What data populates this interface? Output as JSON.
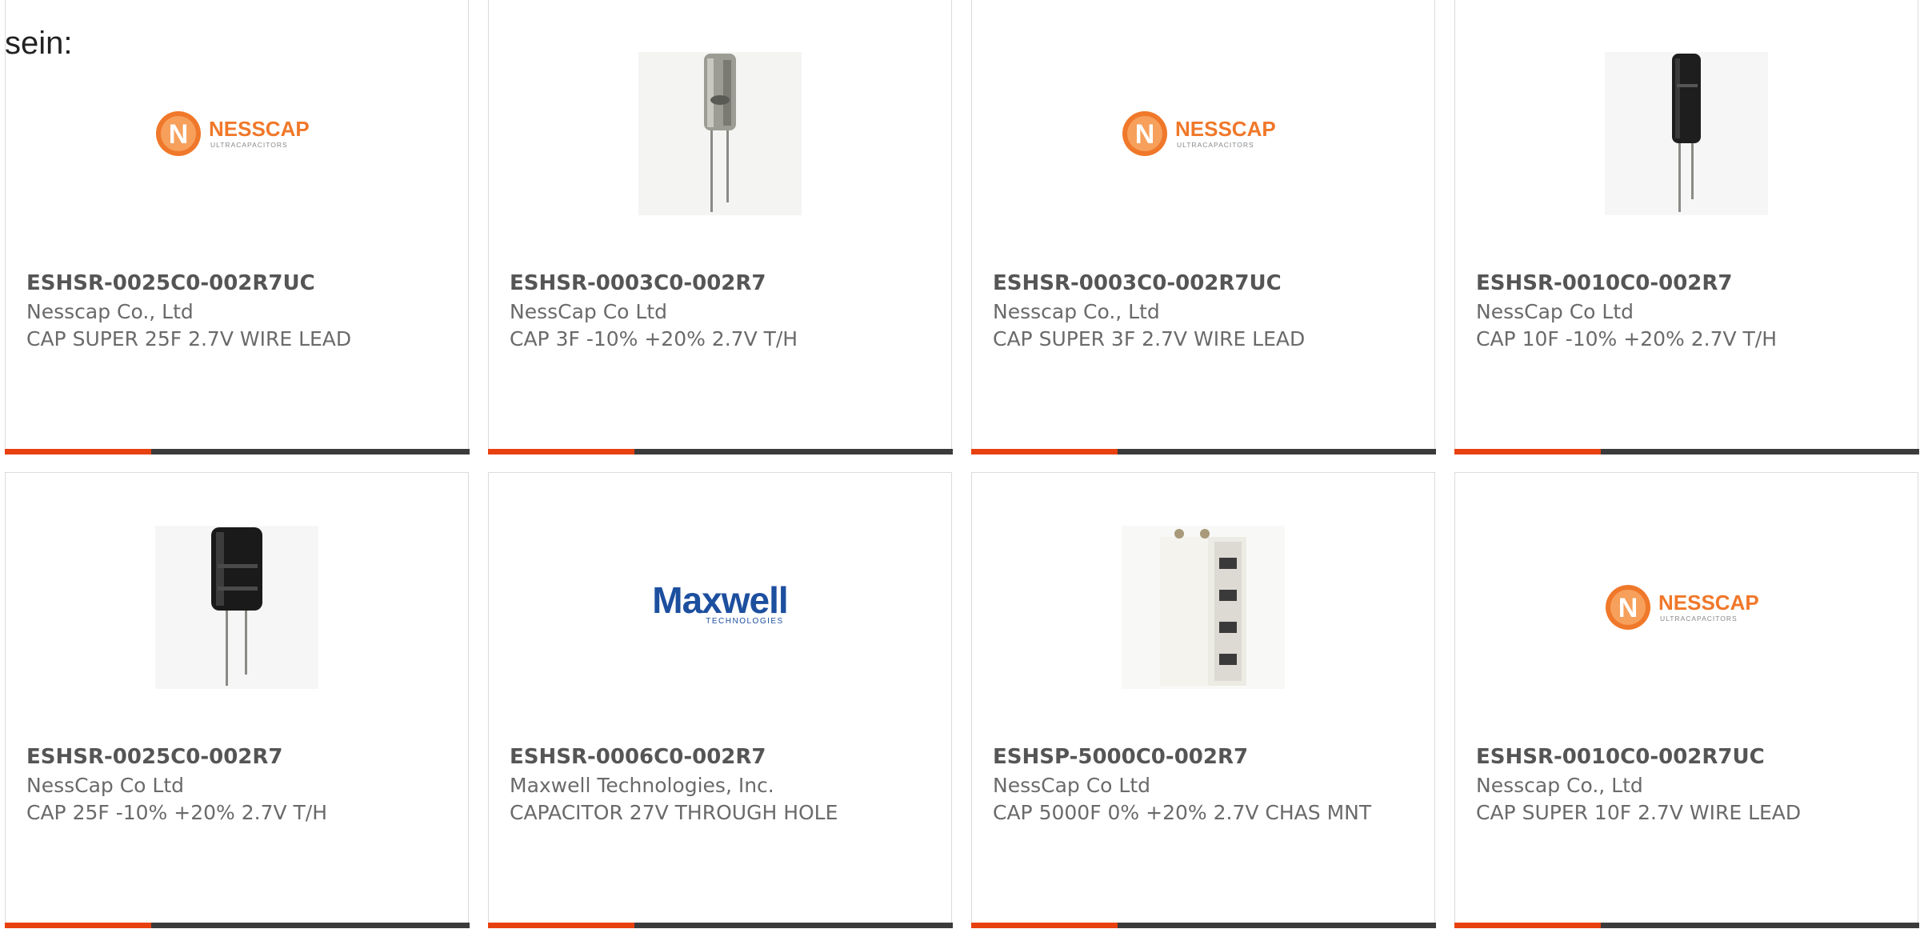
{
  "intro_text": "sein:",
  "colors": {
    "accent": "#e8410f",
    "bar": "#3b3b3b",
    "nesscap_orange": "#f0782a",
    "maxwell_blue": "#1d4f9f"
  },
  "products": [
    {
      "part_number": "ESHSR-0025C0-002R7UC",
      "manufacturer": "Nesscap Co., Ltd",
      "description": "CAP SUPER 25F 2.7V WIRE LEAD",
      "image": "nesscap-logo",
      "logo_text": "NESSCAP",
      "logo_sub": "ULTRACAPACITORS"
    },
    {
      "part_number": "ESHSR-0003C0-002R7",
      "manufacturer": "NessCap Co Ltd",
      "description": "CAP 3F -10% +20% 2.7V T/H",
      "image": "capacitor-small-grey"
    },
    {
      "part_number": "ESHSR-0003C0-002R7UC",
      "manufacturer": "Nesscap Co., Ltd",
      "description": "CAP SUPER 3F 2.7V WIRE LEAD",
      "image": "nesscap-logo",
      "logo_text": "NESSCAP",
      "logo_sub": "ULTRACAPACITORS"
    },
    {
      "part_number": "ESHSR-0010C0-002R7",
      "manufacturer": "NessCap Co Ltd",
      "description": "CAP 10F -10% +20% 2.7V T/H",
      "image": "capacitor-black-slim"
    },
    {
      "part_number": "ESHSR-0025C0-002R7",
      "manufacturer": "NessCap Co Ltd",
      "description": "CAP 25F -10% +20% 2.7V T/H",
      "image": "capacitor-black-wide"
    },
    {
      "part_number": "ESHSR-0006C0-002R7",
      "manufacturer": "Maxwell Technologies, Inc.",
      "description": "CAPACITOR 27V THROUGH HOLE",
      "image": "maxwell-logo",
      "logo_text": "Maxwell",
      "logo_sub": "TECHNOLOGIES"
    },
    {
      "part_number": "ESHSP-5000C0-002R7",
      "manufacturer": "NessCap Co Ltd",
      "description": "CAP 5000F 0% +20% 2.7V CHAS MNT",
      "image": "capacitor-block-white"
    },
    {
      "part_number": "ESHSR-0010C0-002R7UC",
      "manufacturer": "Nesscap Co., Ltd",
      "description": "CAP SUPER 10F 2.7V WIRE LEAD",
      "image": "nesscap-logo",
      "logo_text": "NESSCAP",
      "logo_sub": "ULTRACAPACITORS"
    }
  ]
}
